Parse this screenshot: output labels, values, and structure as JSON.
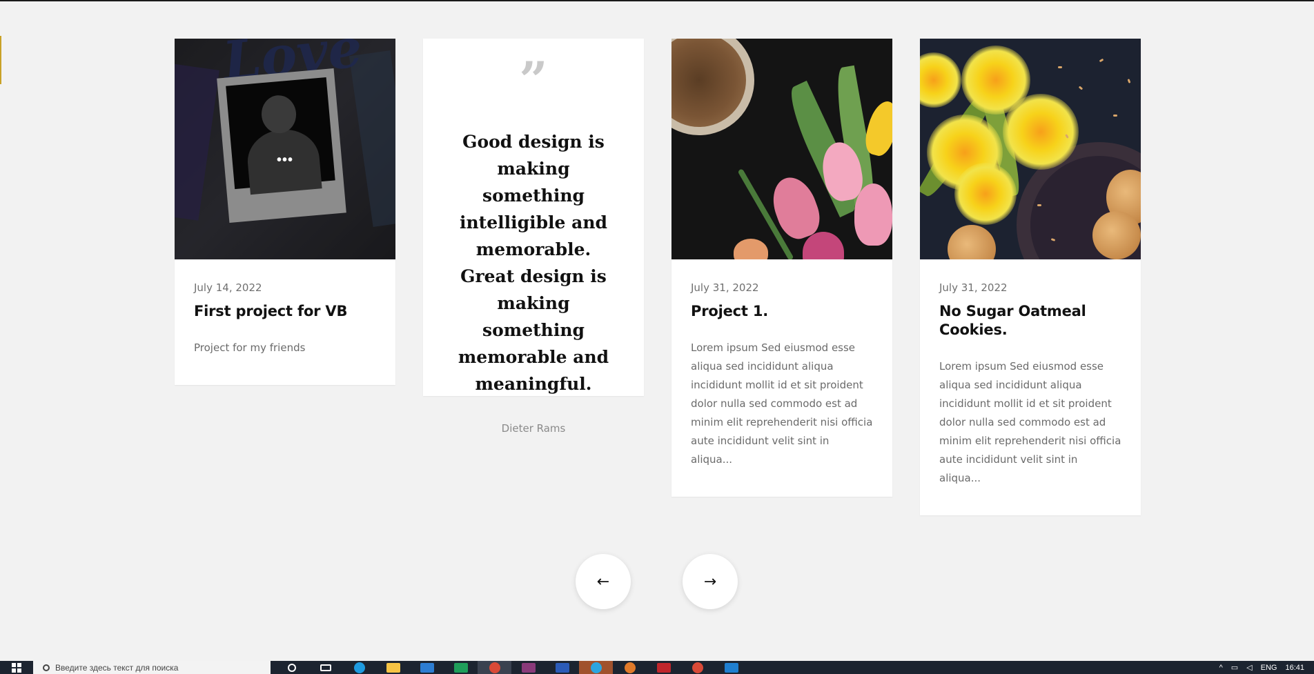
{
  "cards": [
    {
      "date": "July 14, 2022",
      "title": "First project for VB",
      "excerpt": "Project for my friends",
      "image_word": "Love",
      "overlay_icon": "•••"
    },
    {
      "date": "July 31, 2022",
      "title": "Project 1.",
      "excerpt": "Lorem ipsum Sed eiusmod esse aliqua sed incididunt aliqua incididunt mollit id et sit proident dolor nulla sed commodo est ad minim elit reprehenderit nisi officia aute incididunt velit sint in aliqua..."
    },
    {
      "date": "July 31, 2022",
      "title": "No Sugar Oatmeal Cookies.",
      "excerpt": "Lorem ipsum Sed eiusmod esse aliqua sed incididunt aliqua incididunt mollit id et sit proident dolor nulla sed commodo est ad minim elit reprehenderit nisi officia aute incididunt velit sint in aliqua..."
    }
  ],
  "quote": {
    "mark": "”",
    "text": "Good design is making something intelligible and memorable. Great design is making something memorable and meaningful.",
    "author": "Dieter Rams"
  },
  "nav": {
    "prev_icon": "←",
    "next_icon": "→"
  },
  "taskbar": {
    "search_placeholder": "Введите здесь текст для поиска",
    "language": "ENG",
    "time": "16:41",
    "apps": [
      "cortana",
      "task-view",
      "edge",
      "file-explorer",
      "store",
      "excel",
      "chrome",
      "winrar",
      "word",
      "telegram",
      "app-orange",
      "app-red",
      "chrome-2",
      "vscode"
    ]
  },
  "colors": {
    "background": "#f2f2f2",
    "card": "#ffffff",
    "quote_mark": "#c9c9c9",
    "taskbar": "#1c2430"
  }
}
